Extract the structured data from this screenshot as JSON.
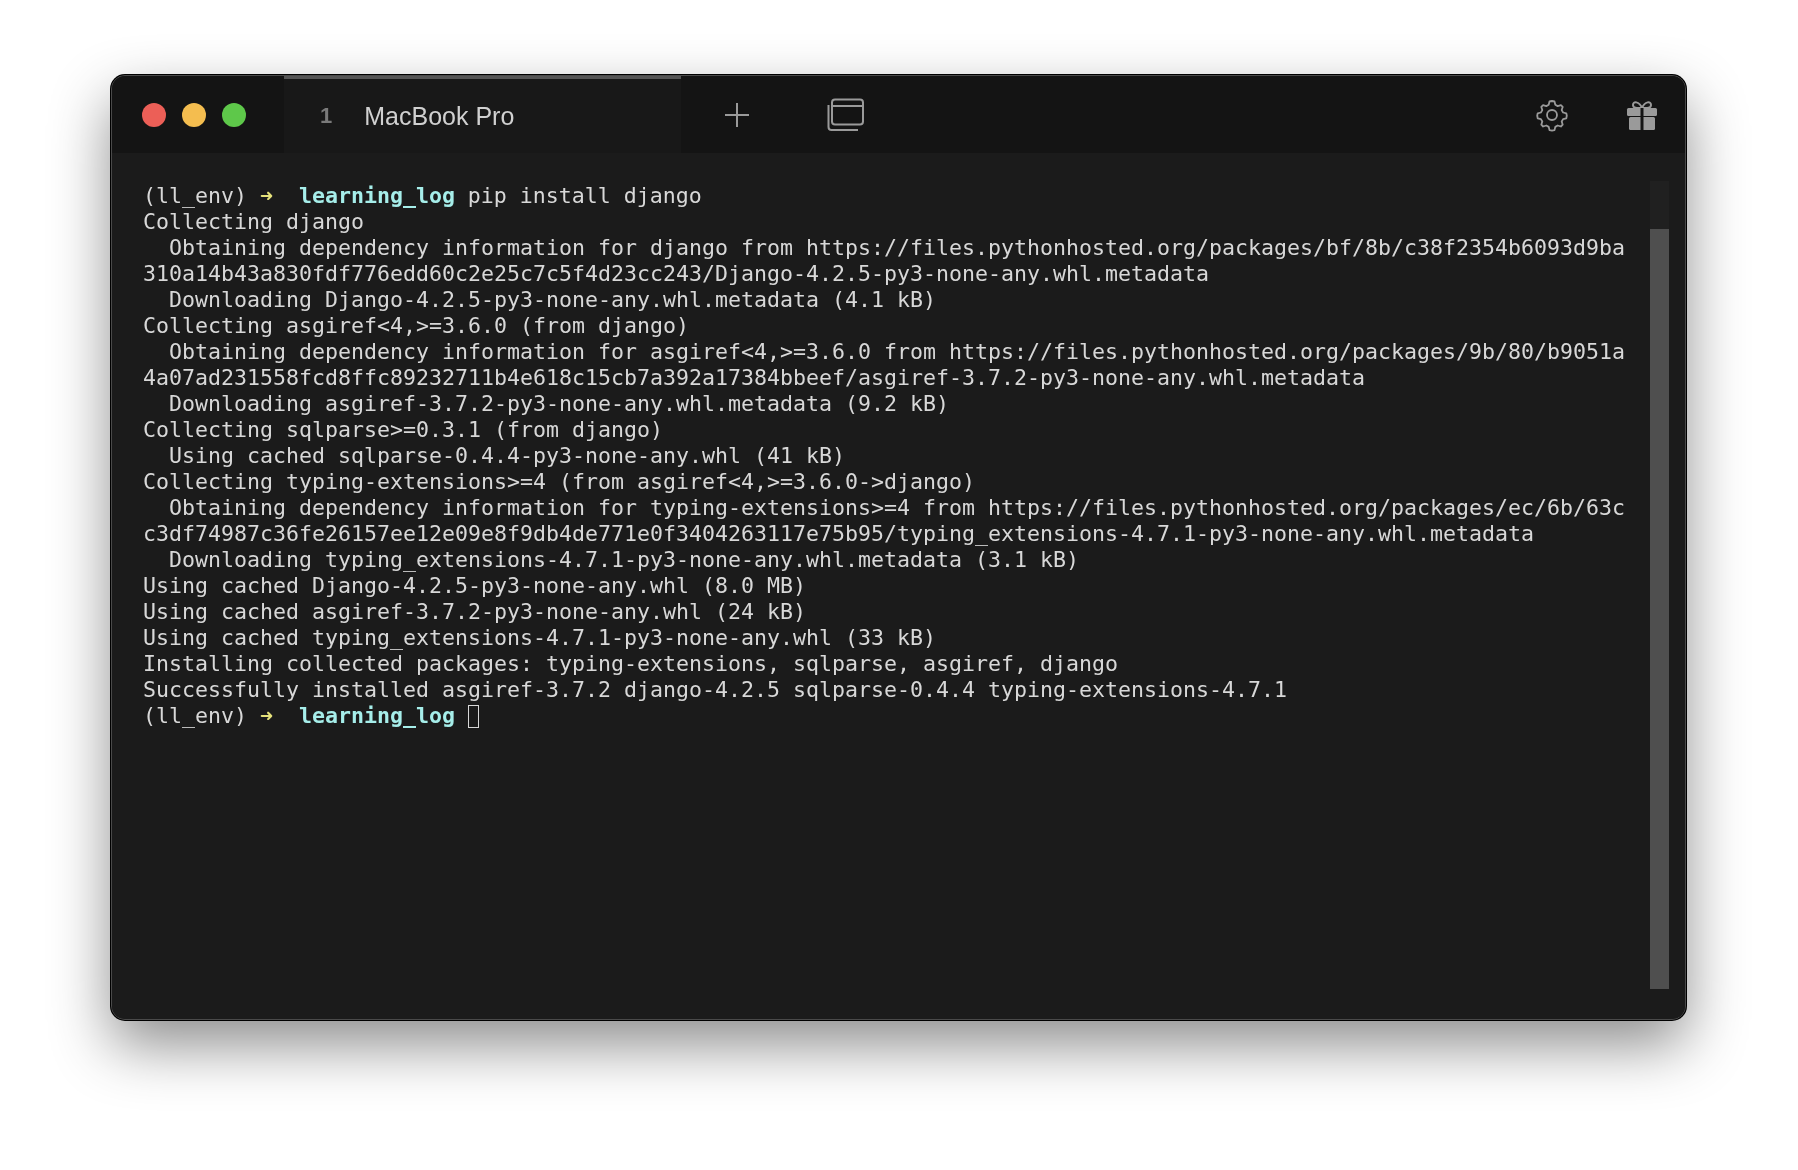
{
  "tabs": [
    {
      "number": "1",
      "title": "MacBook Pro",
      "selected": true
    }
  ],
  "terminal": {
    "lines": [
      {
        "kind": "prompt",
        "env": "(ll_env)",
        "arrow": "➜",
        "directory": "learning_log",
        "command": "pip install django",
        "cursor": false
      },
      {
        "kind": "output",
        "text": "Collecting django"
      },
      {
        "kind": "output",
        "text": "  Obtaining dependency information for django from https://files.pythonhosted.org/packages/bf/8b/c38f2354b6093d9ba"
      },
      {
        "kind": "output",
        "text": "310a14b43a830fdf776edd60c2e25c7c5f4d23cc243/Django-4.2.5-py3-none-any.whl.metadata"
      },
      {
        "kind": "output",
        "text": "  Downloading Django-4.2.5-py3-none-any.whl.metadata (4.1 kB)"
      },
      {
        "kind": "output",
        "text": "Collecting asgiref<4,>=3.6.0 (from django)"
      },
      {
        "kind": "output",
        "text": "  Obtaining dependency information for asgiref<4,>=3.6.0 from https://files.pythonhosted.org/packages/9b/80/b9051a"
      },
      {
        "kind": "output",
        "text": "4a07ad231558fcd8ffc89232711b4e618c15cb7a392a17384bbeef/asgiref-3.7.2-py3-none-any.whl.metadata"
      },
      {
        "kind": "output",
        "text": "  Downloading asgiref-3.7.2-py3-none-any.whl.metadata (9.2 kB)"
      },
      {
        "kind": "output",
        "text": "Collecting sqlparse>=0.3.1 (from django)"
      },
      {
        "kind": "output",
        "text": "  Using cached sqlparse-0.4.4-py3-none-any.whl (41 kB)"
      },
      {
        "kind": "output",
        "text": "Collecting typing-extensions>=4 (from asgiref<4,>=3.6.0->django)"
      },
      {
        "kind": "output",
        "text": "  Obtaining dependency information for typing-extensions>=4 from https://files.pythonhosted.org/packages/ec/6b/63c"
      },
      {
        "kind": "output",
        "text": "c3df74987c36fe26157ee12e09e8f9db4de771e0f3404263117e75b95/typing_extensions-4.7.1-py3-none-any.whl.metadata"
      },
      {
        "kind": "output",
        "text": "  Downloading typing_extensions-4.7.1-py3-none-any.whl.metadata (3.1 kB)"
      },
      {
        "kind": "output",
        "text": "Using cached Django-4.2.5-py3-none-any.whl (8.0 MB)"
      },
      {
        "kind": "output",
        "text": "Using cached asgiref-3.7.2-py3-none-any.whl (24 kB)"
      },
      {
        "kind": "output",
        "text": "Using cached typing_extensions-4.7.1-py3-none-any.whl (33 kB)"
      },
      {
        "kind": "output",
        "text": "Installing collected packages: typing-extensions, sqlparse, asgiref, django"
      },
      {
        "kind": "output",
        "text": "Successfully installed asgiref-3.7.2 django-4.2.5 sqlparse-0.4.4 typing-extensions-4.7.1"
      },
      {
        "kind": "prompt",
        "env": "(ll_env)",
        "arrow": "➜",
        "directory": "learning_log",
        "cursor": true
      }
    ]
  }
}
